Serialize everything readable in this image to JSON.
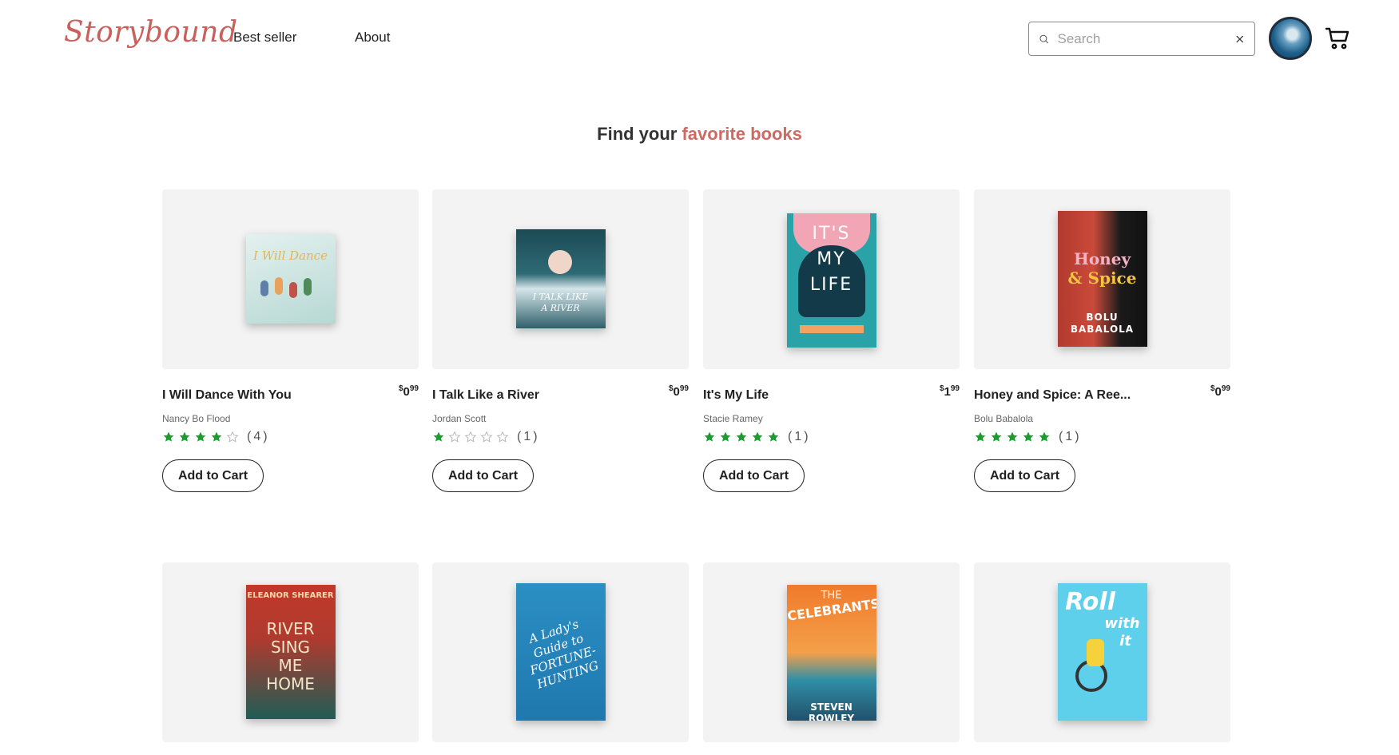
{
  "header": {
    "logo": "Storybound",
    "nav": {
      "best_seller": "Best seller",
      "about": "About"
    },
    "search": {
      "placeholder": "Search",
      "value": ""
    }
  },
  "heading": {
    "prefix": "Find your",
    "accent": "favorite books"
  },
  "button_label": "Add to Cart",
  "colors": {
    "brand": "#c9605c",
    "star": "#1a9c2e",
    "card_bg": "#f3f3f3"
  },
  "books": [
    {
      "title": "I Will Dance With You",
      "author": "Nancy Bo Flood",
      "price_main": "0",
      "price_cents": "99",
      "rating": 4,
      "reviews": "(4)",
      "cover_lines": [
        "I Will Dance"
      ]
    },
    {
      "title": "I Talk Like a River",
      "author": "Jordan Scott",
      "price_main": "0",
      "price_cents": "99",
      "rating": 1,
      "reviews": "(1)",
      "cover_lines": [
        "I TALK LIKE",
        "A RIVER"
      ]
    },
    {
      "title": "It's My Life",
      "author": "Stacie Ramey",
      "price_main": "1",
      "price_cents": "99",
      "rating": 5,
      "reviews": "(1)",
      "cover_lines": [
        "IT'S",
        "MY",
        "LIFE"
      ]
    },
    {
      "title": "Honey and Spice: A Ree...",
      "author": "Bolu Babalola",
      "price_main": "0",
      "price_cents": "99",
      "rating": 5,
      "reviews": "(1)",
      "cover_lines": [
        "Honey",
        "& Spice",
        "BOLU",
        "BABALOLA"
      ]
    },
    {
      "cover_lines": [
        "ELEANOR SHEARER",
        "RIVER",
        "SING",
        "ME",
        "HOME"
      ]
    },
    {
      "cover_lines": [
        "A Lady's",
        "Guide to",
        "FORTUNE-",
        "HUNTING"
      ]
    },
    {
      "cover_lines": [
        "THE",
        "CELEBRANTS",
        "STEVEN ROWLEY"
      ]
    },
    {
      "cover_lines": [
        "Roll",
        "with",
        "it"
      ]
    }
  ]
}
